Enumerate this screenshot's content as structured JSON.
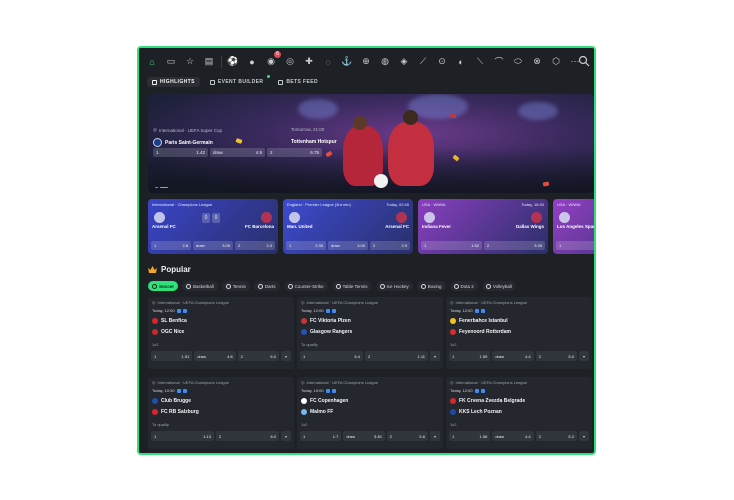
{
  "nav": {
    "icons": [
      "home-icon",
      "live-icon",
      "star-icon",
      "betslip-icon",
      "stats-icon",
      "football-icon",
      "basketball-icon",
      "tennis-icon",
      "darts-icon",
      "counter-strike-icon",
      "table-tennis-icon",
      "ice-hockey-icon",
      "boxing-icon",
      "dota2-icon",
      "volleyball-icon",
      "badminton-icon",
      "baseball-icon",
      "handball-icon",
      "cricket-icon",
      "golf-icon",
      "rugby-icon",
      "mma-icon",
      "futsal-icon",
      "more-icon"
    ],
    "badge": "6"
  },
  "tabs": [
    {
      "label": "HIGHLIGHTS",
      "active": true
    },
    {
      "label": "EVENT BUILDER",
      "active": false,
      "dot": true
    },
    {
      "label": "BETS FEED",
      "active": false
    }
  ],
  "hero": {
    "competition": "International · UEFA Super Cup",
    "team1": "Paris Saint-Germain",
    "team2": "Tottenham Hotspur",
    "odds": [
      {
        "label": "1",
        "value": "1.42"
      },
      {
        "label": "draw",
        "value": "4.9"
      },
      {
        "label": "2",
        "value": "6.75"
      }
    ]
  },
  "live_cards": [
    {
      "competition": "International · Champions League",
      "time": "",
      "team1": "Arsenal FC",
      "team2": "FC Barcelona",
      "score": [
        "0",
        "0"
      ],
      "odds": [
        {
          "label": "1",
          "value": "2.8"
        },
        {
          "label": "draw",
          "value": "3.05"
        },
        {
          "label": "2",
          "value": "2.3"
        }
      ],
      "bg": "#3a45c8"
    },
    {
      "competition": "England · Premier League (3rd min)",
      "time": "Today, 02:45",
      "team1": "Man. United",
      "team2": "Arsenal FC",
      "score": [],
      "odds": [
        {
          "label": "1",
          "value": "2.35"
        },
        {
          "label": "draw",
          "value": "3.05"
        },
        {
          "label": "2",
          "value": "2.9"
        }
      ],
      "bg": "#3d4bd0"
    },
    {
      "competition": "USA · WNBA",
      "time": "Today, 16:30",
      "team1": "Indiana Fever",
      "team2": "Dallas Wings",
      "score": [],
      "odds": [
        {
          "label": "1",
          "value": "1.52"
        },
        {
          "label": "2",
          "value": "3.35"
        }
      ],
      "bg": "#8a3fbf"
    },
    {
      "competition": "USA · WNBA",
      "time": "",
      "team1": "Los Angeles Sparks",
      "team2": "",
      "score": [],
      "odds": [
        {
          "label": "1",
          "value": ""
        }
      ],
      "bg": "#9440c4"
    }
  ],
  "popular": {
    "title": "Popular",
    "sports": [
      {
        "label": "Soccer",
        "active": true
      },
      {
        "label": "Basketball"
      },
      {
        "label": "Tennis"
      },
      {
        "label": "Darts"
      },
      {
        "label": "Counter-Strike"
      },
      {
        "label": "Table Tennis"
      },
      {
        "label": "Ice Hockey"
      },
      {
        "label": "Boxing"
      },
      {
        "label": "Dota 2"
      },
      {
        "label": "Volleyball"
      }
    ],
    "matches": [
      {
        "competition": "International · UEFA Champions League",
        "time": "Today, 12:00",
        "team1": "SL Benfica",
        "team2": "OGC Nice",
        "market": "1x2",
        "odds": [
          {
            "label": "1",
            "value": "1.51"
          },
          {
            "label": "draw",
            "value": "4.8"
          },
          {
            "label": "2",
            "value": "6.0"
          }
        ],
        "c1": "#d9262b",
        "c2": "#c52b2b"
      },
      {
        "competition": "International · UEFA Champions League",
        "time": "Today, 12:00",
        "team1": "FC Viktoria Plzen",
        "team2": "Glasgow Rangers",
        "market": "To qualify",
        "odds": [
          {
            "label": "1",
            "value": "6.4"
          },
          {
            "label": "2",
            "value": "1.11"
          }
        ],
        "c1": "#c73434",
        "c2": "#2452b5"
      },
      {
        "competition": "International · UEFA Champions League",
        "time": "Today, 12:00",
        "team1": "Fenerbahce Istanbul",
        "team2": "Feyenoord Rotterdam",
        "market": "1x2",
        "odds": [
          {
            "label": "1",
            "value": "1.59"
          },
          {
            "label": "draw",
            "value": "4.4"
          },
          {
            "label": "2",
            "value": "5.0"
          }
        ],
        "c1": "#f2c318",
        "c2": "#d72c2c"
      },
      {
        "competition": "International · UEFA Champions League",
        "time": "Today, 10:30",
        "team1": "Club Brugge",
        "team2": "FC RB Salzburg",
        "market": "To qualify",
        "odds": [
          {
            "label": "1",
            "value": "1.13"
          },
          {
            "label": "2",
            "value": "6.0"
          }
        ],
        "c1": "#1f4ea8",
        "c2": "#d8262f"
      },
      {
        "competition": "International · UEFA Champions League",
        "time": "Today, 10:00",
        "team1": "FC Copenhagen",
        "team2": "Malmo FF",
        "market": "1x2",
        "odds": [
          {
            "label": "1",
            "value": "1.7"
          },
          {
            "label": "draw",
            "value": "3.45"
          },
          {
            "label": "2",
            "value": "5.6"
          }
        ],
        "c1": "#ffffff",
        "c2": "#78b7ea"
      },
      {
        "competition": "International · UEFA Champions League",
        "time": "Today, 12:00",
        "team1": "FK Crvena Zvezda Belgrade",
        "team2": "KKS Lech Poznan",
        "market": "1x2",
        "odds": [
          {
            "label": "1",
            "value": "1.56"
          },
          {
            "label": "draw",
            "value": "4.4"
          },
          {
            "label": "2",
            "value": "5.2"
          }
        ],
        "c1": "#d62a2a",
        "c2": "#1e4aa6"
      }
    ]
  },
  "colors": {
    "accent": "#2ee27a",
    "bg": "#1d2024",
    "card": "#24282e"
  }
}
